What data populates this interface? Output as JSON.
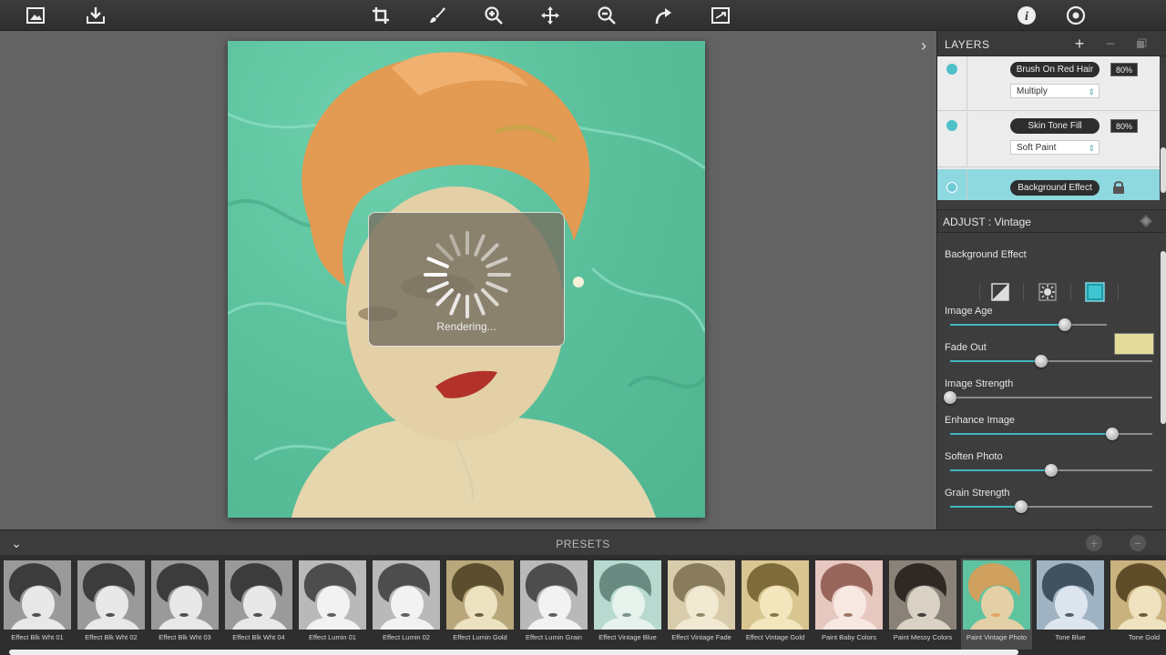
{
  "toolbar": {
    "left_icons": [
      "image-frame-icon",
      "save-download-icon"
    ],
    "center_icons": [
      "crop-icon",
      "brush-icon",
      "zoom-in-icon",
      "move-icon",
      "zoom-out-icon",
      "redo-icon",
      "fit-screen-icon"
    ],
    "right_icons": [
      "info-icon",
      "settings-icon"
    ]
  },
  "canvas": {
    "rendering_label": "Rendering...",
    "photo_description_colors": {
      "background": "#5cc39e",
      "hair": "#e39a52",
      "skin": "#e3d0a6",
      "lips": "#b2322a"
    }
  },
  "layers_panel": {
    "title": "LAYERS",
    "add_label": "+",
    "remove_label": "−",
    "items": [
      {
        "name": "Brush On Red Hair",
        "opacity": "80%",
        "blend": "Multiply",
        "selected": false
      },
      {
        "name": "Skin Tone Fill",
        "opacity": "80%",
        "blend": "Soft Paint",
        "selected": false
      },
      {
        "name": "Background Effect",
        "opacity": "",
        "blend": "",
        "selected": true,
        "locked": true
      }
    ]
  },
  "adjust_panel": {
    "title": "ADJUST : Vintage",
    "section_label": "Background Effect",
    "mode_icons": [
      "contrast-mode-icon",
      "sun-mode-icon",
      "square-mode-icon"
    ],
    "sliders": [
      {
        "label": "Image Age",
        "value": 0.73
      },
      {
        "label": "Fade Out",
        "value": 0.45
      },
      {
        "label": "Image Strength",
        "value": 0.0
      },
      {
        "label": "Enhance Image",
        "value": 0.8
      },
      {
        "label": "Soften Photo",
        "value": 0.5
      },
      {
        "label": "Grain Strength",
        "value": 0.35
      }
    ],
    "age_color": "#e4dc9a",
    "accent": "#3fb6bd"
  },
  "presets": {
    "title": "PRESETS",
    "items": [
      {
        "label": "Effect Blk Wht 01",
        "tone": "bw"
      },
      {
        "label": "Effect Blk Wht 02",
        "tone": "bw"
      },
      {
        "label": "Effect Blk Wht 03",
        "tone": "bw"
      },
      {
        "label": "Effect Blk Wht 04",
        "tone": "bw"
      },
      {
        "label": "Effect Lumin 01",
        "tone": "bwlight"
      },
      {
        "label": "Effect Lumin 02",
        "tone": "bwlight"
      },
      {
        "label": "Effect Lumin Gold",
        "tone": "gold"
      },
      {
        "label": "Effect Lumin Grain",
        "tone": "bwlight"
      },
      {
        "label": "Effect Vintage Blue",
        "tone": "blue"
      },
      {
        "label": "Effect Vintage Fade",
        "tone": "fade"
      },
      {
        "label": "Effect Vintage Gold",
        "tone": "vgold"
      },
      {
        "label": "Paint Baby Colors",
        "tone": "pink"
      },
      {
        "label": "Paint Messy Colors",
        "tone": "dark"
      },
      {
        "label": "Paint Vintage Photo",
        "tone": "vintage",
        "selected": true
      },
      {
        "label": "Tone Blue",
        "tone": "toneblue"
      },
      {
        "label": "Tone Gold",
        "tone": "tonegold"
      }
    ]
  }
}
